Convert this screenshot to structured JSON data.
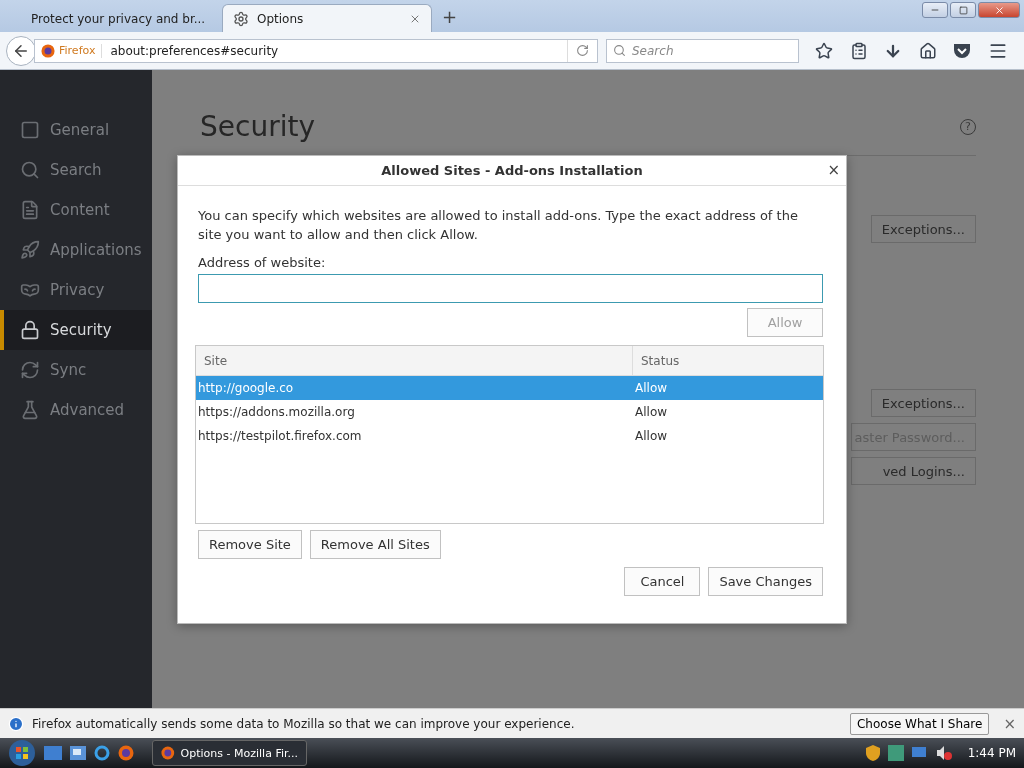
{
  "tabs": [
    {
      "title": "Protect your privacy and br...",
      "selected": false
    },
    {
      "title": "Options",
      "selected": true
    }
  ],
  "new_tab": "+",
  "address_bar": {
    "identity": "Firefox",
    "url": "about:preferences#security"
  },
  "search": {
    "placeholder": "Search"
  },
  "sidebar": {
    "items": [
      {
        "label": "General",
        "selected": false
      },
      {
        "label": "Search",
        "selected": false
      },
      {
        "label": "Content",
        "selected": false
      },
      {
        "label": "Applications",
        "selected": false
      },
      {
        "label": "Privacy",
        "selected": false
      },
      {
        "label": "Security",
        "selected": true
      },
      {
        "label": "Sync",
        "selected": false
      },
      {
        "label": "Advanced",
        "selected": false
      }
    ]
  },
  "page": {
    "title": "Security",
    "help": "?",
    "buttons": [
      {
        "label": "Exceptions..."
      },
      {
        "label": "Exceptions..."
      },
      {
        "label": "aster Password..."
      },
      {
        "label": "ved Logins..."
      }
    ]
  },
  "dialog": {
    "title": "Allowed Sites - Add-ons Installation",
    "close": "×",
    "description": "You can specify which websites are allowed to install add-ons. Type the exact address of the site you want to allow and then click Allow.",
    "address_label": "Address of website:",
    "allow_button": {
      "label": "Allow",
      "disabled": true
    },
    "columns": [
      "Site",
      "Status"
    ],
    "rows": [
      {
        "site": "http://google.co",
        "status": "Allow",
        "selected": true
      },
      {
        "site": "https://addons.mozilla.org",
        "status": "Allow",
        "selected": false
      },
      {
        "site": "https://testpilot.firefox.com",
        "status": "Allow",
        "selected": false
      }
    ],
    "list_buttons": [
      "Remove Site",
      "Remove All Sites"
    ],
    "footer_buttons": [
      "Cancel",
      "Save Changes"
    ]
  },
  "notification": {
    "message": "Firefox automatically sends some data to Mozilla so that we can improve your experience.",
    "button": "Choose What I Share",
    "close": "×"
  },
  "taskbar": {
    "window": "Options - Mozilla Fir...",
    "clock": "1:44 PM"
  }
}
